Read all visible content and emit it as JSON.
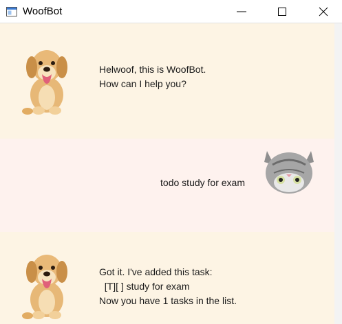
{
  "window": {
    "title": "WoofBot",
    "controls": [
      "minimize",
      "maximize",
      "close"
    ]
  },
  "messages": [
    {
      "sender": "bot",
      "avatar": "puppy-avatar",
      "lines": [
        "Helwoof, this is WoofBot.",
        "How can I help you?"
      ]
    },
    {
      "sender": "user",
      "avatar": "cat-avatar",
      "lines": [
        "todo study for exam"
      ]
    },
    {
      "sender": "bot",
      "avatar": "puppy-avatar",
      "lines": [
        "Got it. I've added this task:",
        "  [T][ ] study for exam",
        "Now you have 1 tasks in the list."
      ]
    }
  ],
  "colors": {
    "bot_bubble": "#fdf4e4",
    "user_bubble": "#fef2ee",
    "text": "#1a1a1a"
  }
}
